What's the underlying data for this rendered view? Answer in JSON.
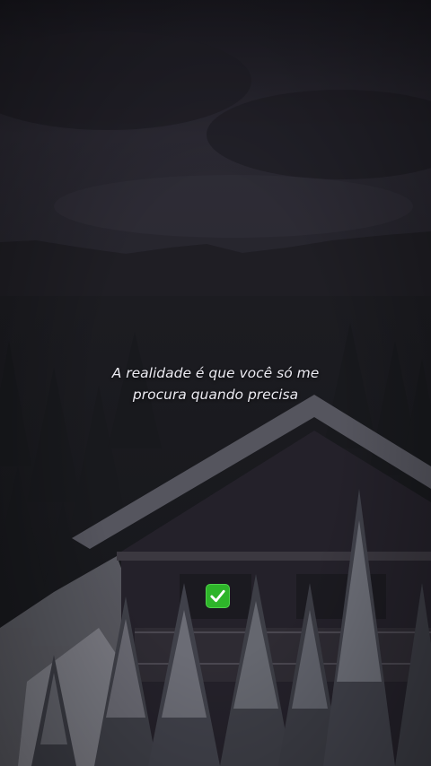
{
  "caption": {
    "line1": "A realidade é que você só me",
    "line2": "procura quando precisa"
  },
  "emoji": {
    "icon": "check-mark-button-icon",
    "color": "#2eb52a"
  },
  "colors": {
    "sky": "#2a2832",
    "mountains": "#1d1c22",
    "forest": "#1a1b1f",
    "snow": "#8e8f97",
    "cabin": "#26232a"
  }
}
